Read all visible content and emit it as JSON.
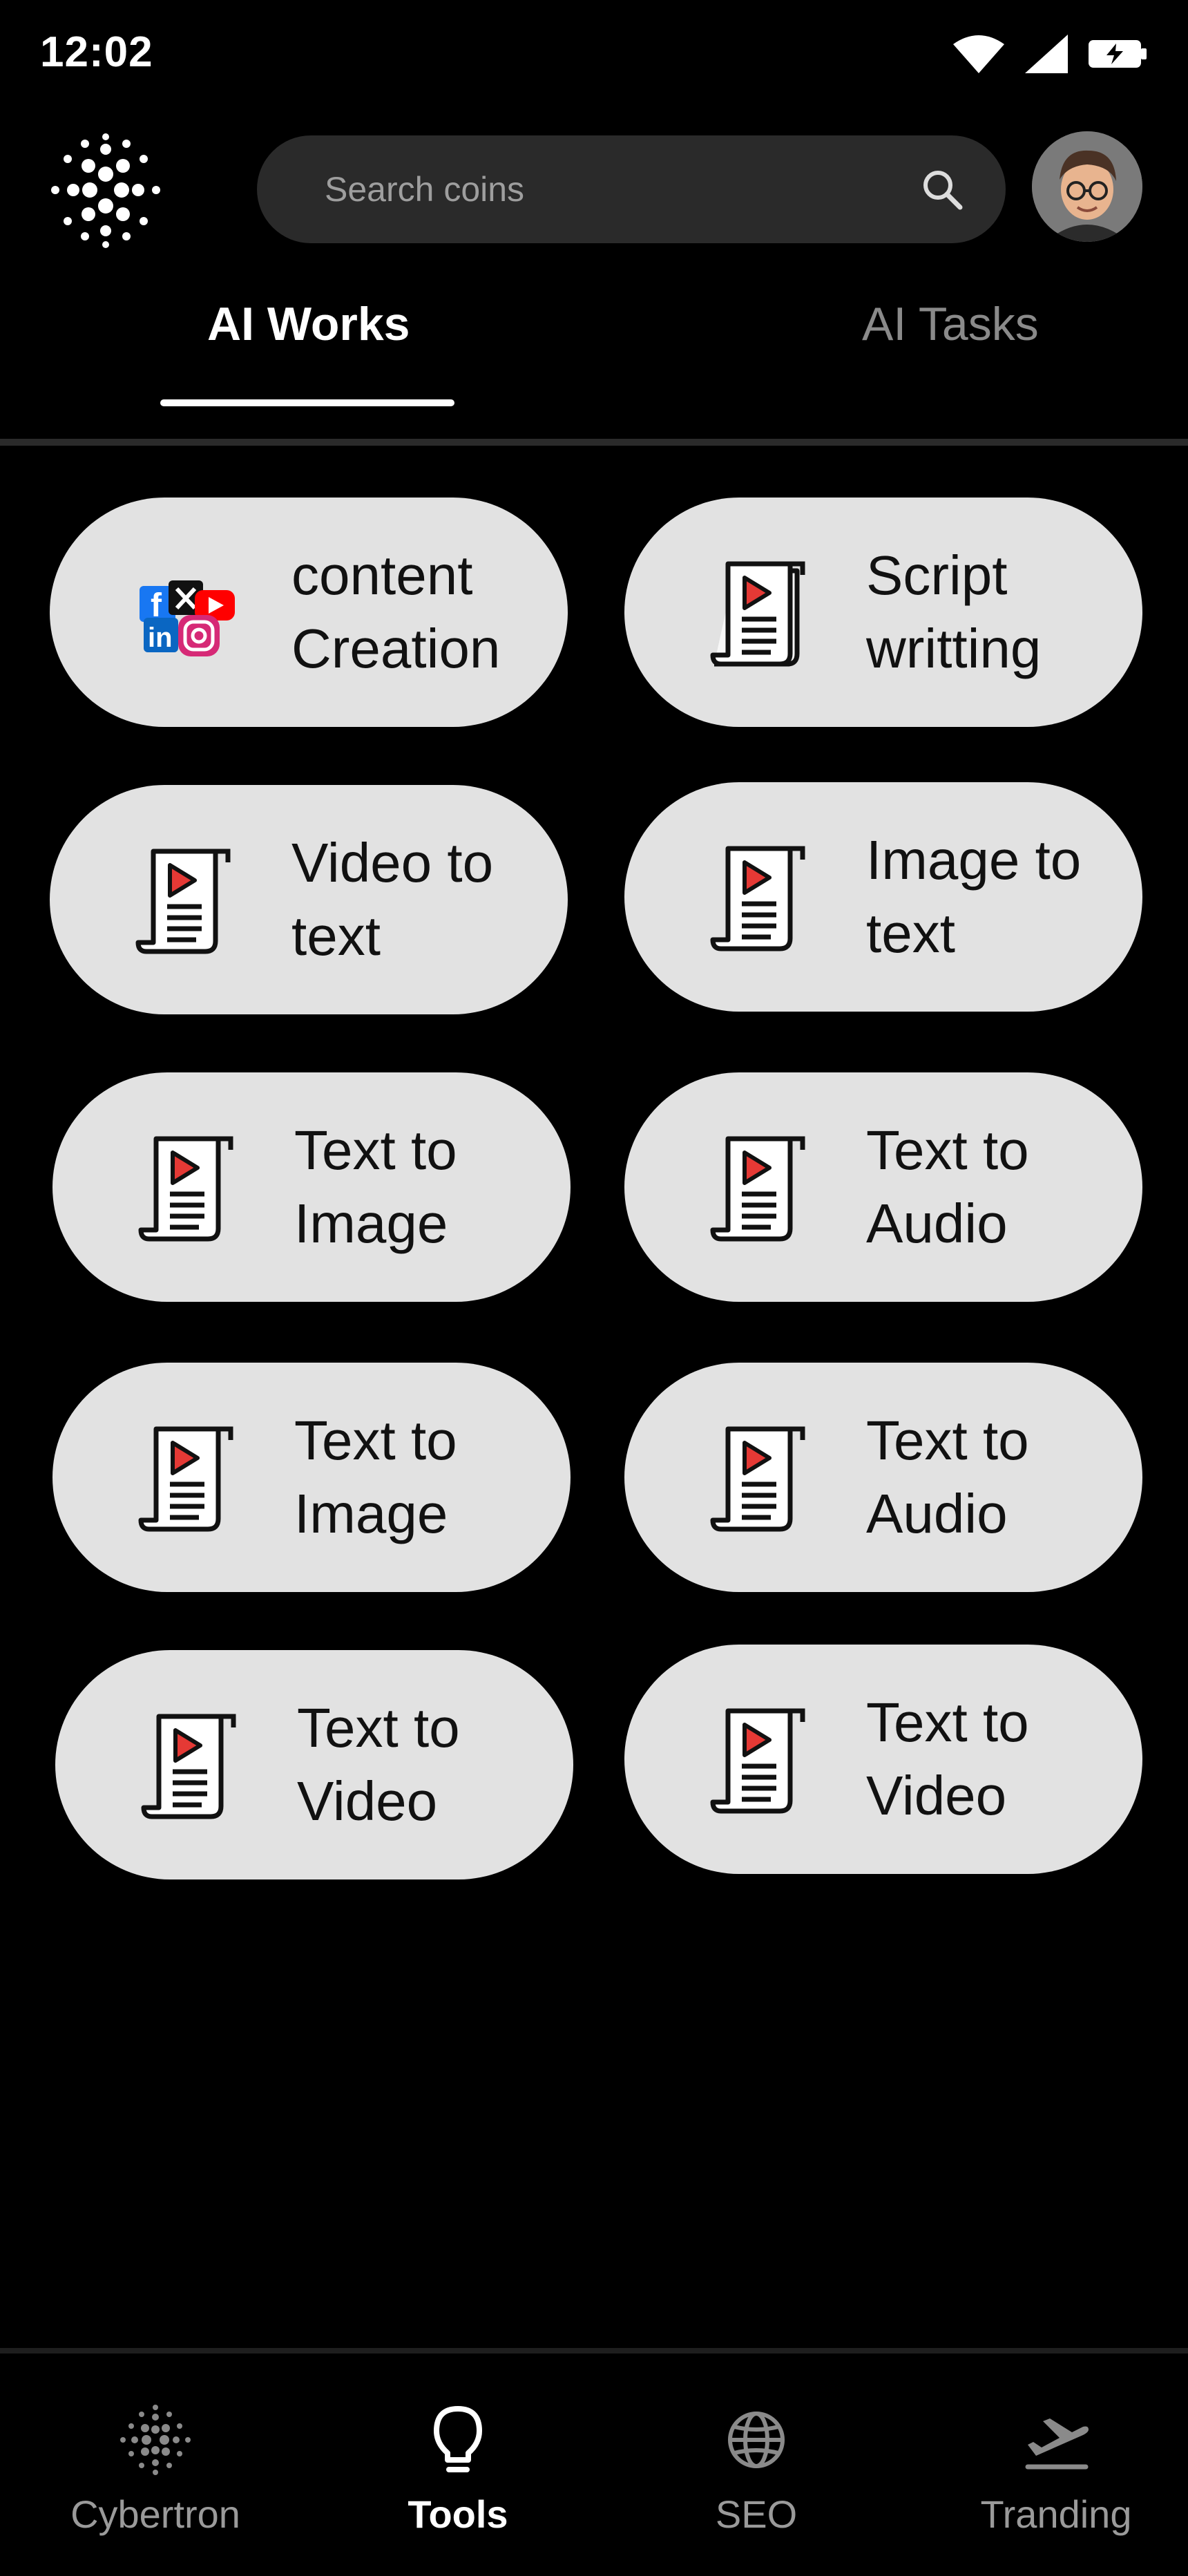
{
  "status": {
    "time": "12:02"
  },
  "search": {
    "placeholder": "Search coins"
  },
  "tabs": [
    {
      "label": "AI Works",
      "active": true
    },
    {
      "label": "AI Tasks",
      "active": false
    }
  ],
  "cards": [
    {
      "label": "content\nCreation",
      "icon": "social-media-icon"
    },
    {
      "label": "Script\nwritting",
      "icon": "video-script-icon"
    },
    {
      "label": "Video to\ntext",
      "icon": "video-script-icon"
    },
    {
      "label": "Image to\ntext",
      "icon": "video-script-icon"
    },
    {
      "label": "Text to\nImage",
      "icon": "video-script-icon"
    },
    {
      "label": "Text to\nAudio",
      "icon": "video-script-icon"
    },
    {
      "label": "Text to\nImage",
      "icon": "video-script-icon"
    },
    {
      "label": "Text to\nAudio",
      "icon": "video-script-icon"
    },
    {
      "label": "Text to\nVideo",
      "icon": "video-script-icon"
    },
    {
      "label": "Text to\nVideo",
      "icon": "video-script-icon"
    }
  ],
  "nav": [
    {
      "label": "Cybertron",
      "icon": "dots-icon",
      "active": false
    },
    {
      "label": "Tools",
      "icon": "lightbulb-icon",
      "active": true
    },
    {
      "label": "SEO",
      "icon": "globe-icon",
      "active": false
    },
    {
      "label": "Tranding",
      "icon": "airplane-takeoff-icon",
      "active": false
    }
  ],
  "colors": {
    "card_bg": "#e2e2e2",
    "play_red": "#e53935",
    "search_bg": "#2a2a2a"
  }
}
